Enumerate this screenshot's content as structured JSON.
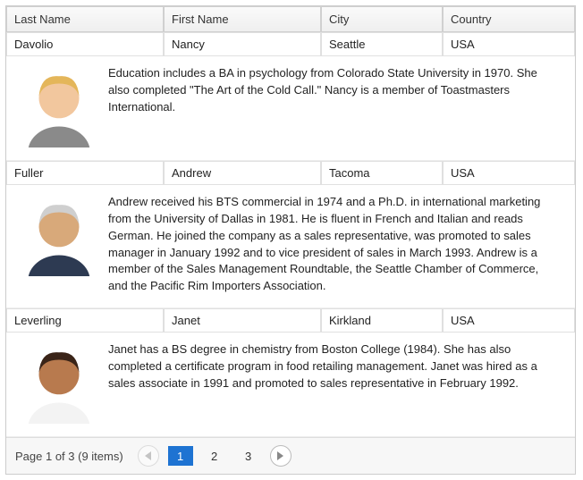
{
  "columns": {
    "last_name": "Last Name",
    "first_name": "First Name",
    "city": "City",
    "country": "Country"
  },
  "rows": [
    {
      "last_name": "Davolio",
      "first_name": "Nancy",
      "city": "Seattle",
      "country": "USA",
      "detail": "Education includes a BA in psychology from Colorado State University in 1970. She also completed \"The Art of the Cold Call.\" Nancy is a member of Toastmasters International.",
      "avatar": {
        "skin": "#f2c79e",
        "hair": "#e4b65a",
        "shirt": "#8a8a8a"
      }
    },
    {
      "last_name": "Fuller",
      "first_name": "Andrew",
      "city": "Tacoma",
      "country": "USA",
      "detail": "Andrew received his BTS commercial in 1974 and a Ph.D. in international marketing from the University of Dallas in 1981. He is fluent in French and Italian and reads German. He joined the company as a sales representative, was promoted to sales manager in January 1992 and to vice president of sales in March 1993. Andrew is a member of the Sales Management Roundtable, the Seattle Chamber of Commerce, and the Pacific Rim Importers Association.",
      "avatar": {
        "skin": "#d8a97a",
        "hair": "#cfcfcf",
        "shirt": "#2d3a52"
      }
    },
    {
      "last_name": "Leverling",
      "first_name": "Janet",
      "city": "Kirkland",
      "country": "USA",
      "detail": "Janet has a BS degree in chemistry from Boston College (1984). She has also completed a certificate program in food retailing management. Janet was hired as a sales associate in 1991 and promoted to sales representative in February 1992.",
      "avatar": {
        "skin": "#b87a4e",
        "hair": "#3a2418",
        "shirt": "#f3f3f3"
      }
    }
  ],
  "pager": {
    "summary": "Page 1 of 3 (9 items)",
    "pages": [
      "1",
      "2",
      "3"
    ],
    "current_index": 0,
    "prev_disabled": true,
    "next_disabled": false
  }
}
